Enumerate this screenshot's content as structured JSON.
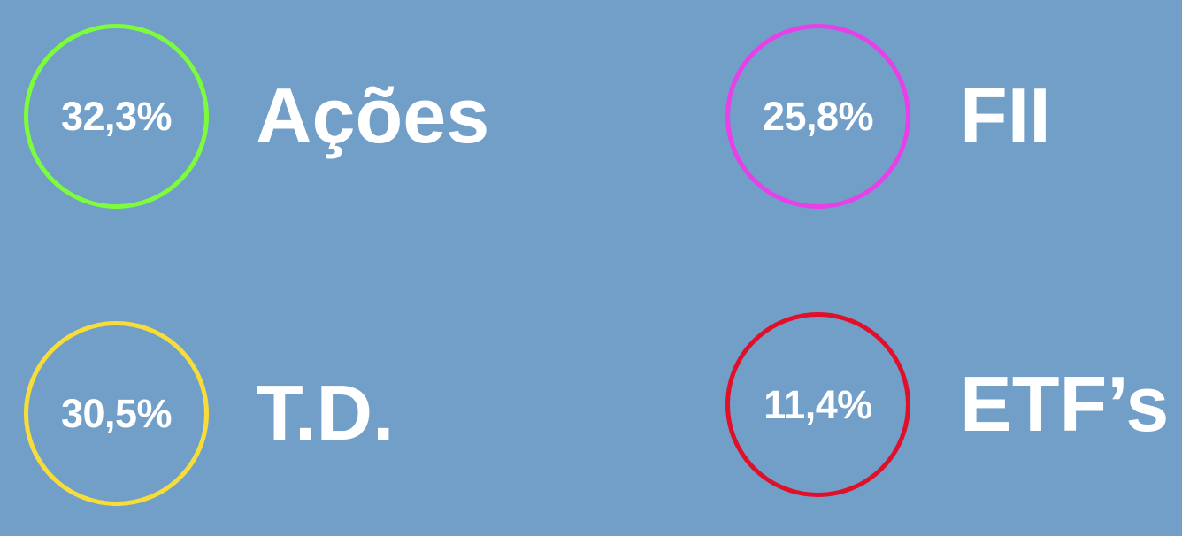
{
  "allocations": [
    {
      "percent": "32,3%",
      "label": "Ações",
      "color": "#7dfc3c"
    },
    {
      "percent": "25,8%",
      "label": "FII",
      "color": "#e83fe8"
    },
    {
      "percent": "30,5%",
      "label": "T.D.",
      "color": "#f7dd3a"
    },
    {
      "percent": "11,4%",
      "label": "ETF’s",
      "color": "#e0102a"
    }
  ],
  "colors": {
    "background": "#719fc7",
    "text": "#ffffff"
  }
}
